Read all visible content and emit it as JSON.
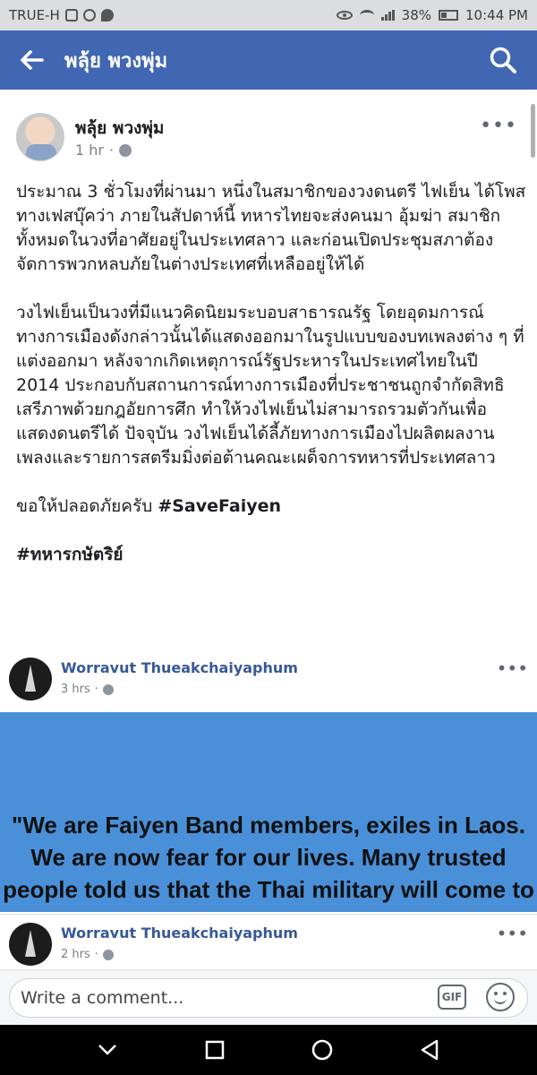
{
  "status_bar": {
    "carrier": "TRUE-H",
    "battery": "38%",
    "time": "10:44 PM"
  },
  "header": {
    "title": "พลุ้ย พวงพุ่ม"
  },
  "post": {
    "author": "พลุ้ย พวงพุ่ม",
    "time": "1 hr",
    "separator": "·",
    "paragraphs": [
      "ประมาณ 3 ชั่วโมงที่ผ่านมา หนึ่งในสมาชิกของวงดนตรี ไฟเย็น ได้โพสทางเฟสบุ๊คว่า ภายในสัปดาห์นี้ ทหารไทยจะส่งคนมา อุ้มฆ่า สมาชิกทั้งหมดในวงที่อาศัยอยู่ในประเทศลาว และก่อนเปิดประชุมสภาต้องจัดการพวกหลบภัยในต่างประเทศที่เหลืออยู่ให้ได้",
      "วงไฟเย็นเป็นวงที่มีแนวคิดนิยมระบอบสาธารณรัฐ โดยอุดมการณ์ทางการเมืองดังกล่าวนั้นได้แสดงออกมาในรูปแบบของบทเพลงต่าง ๆ ที่แต่งออกมา หลังจากเกิดเหตุการณ์รัฐประหารในประเทศไทยในปี 2014 ประกอบกับสถานการณ์ทางการเมืองที่ประชาชนถูกจำกัดสิทธิเสรีภาพด้วยกฎอัยการศึก ทำให้วงไฟเย็นไม่สามารถรวมตัวกันเพื่อแสดงดนตรีได้ ปัจจุบัน วงไฟเย็นได้ลี้ภัยทางการเมืองไปผลิตผลงานเพลงและรายการสตรีมมิ่งต่อต้านคณะเผด็จการทหารที่ประเทศลาว"
    ],
    "closing": "ขอให้ปลอดภัยครับ ",
    "hashtag1": "#SaveFaiyen",
    "hashtag2": "#ทหารกษัตริย์"
  },
  "comments": [
    {
      "name": "Worravut Thueakchaiyaphum",
      "time": "3 hrs",
      "separator": "·",
      "image_text": "\"We are Faiyen Band members, exiles in Laos. We are now fear for our lives. Many trusted people told us that the Thai military will come to kill us within"
    },
    {
      "name": "Worravut Thueakchaiyaphum",
      "time": "2 hrs",
      "separator": "·"
    }
  ],
  "composer": {
    "placeholder": "Write a comment...",
    "gif_label": "GIF"
  },
  "icons": {
    "back": "arrow-left-icon",
    "search": "search-icon",
    "more": "more-horizontal-icon",
    "globe": "globe-icon",
    "emoji": "smiley-icon"
  },
  "colors": {
    "header_bg": "#4267b2",
    "link": "#385898",
    "banner_bg": "#4a90d9"
  }
}
